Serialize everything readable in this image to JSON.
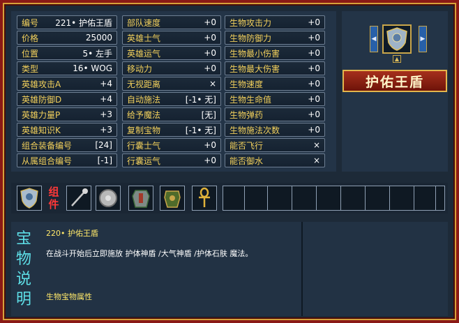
{
  "stats": {
    "col1": [
      {
        "label": "编号",
        "value": "221• 护佑王盾"
      },
      {
        "label": "价格",
        "value": "25000"
      },
      {
        "label": "位置",
        "value": "5• 左手"
      },
      {
        "label": "类型",
        "value": "16• WOG"
      },
      {
        "label": "英雄攻击A",
        "value": "+4"
      },
      {
        "label": "英雄防御D",
        "value": "+4"
      },
      {
        "label": "英雄力量P",
        "value": "+3"
      },
      {
        "label": "英雄知识K",
        "value": "+3"
      },
      {
        "label": "组合装备编号",
        "value": "[24]"
      },
      {
        "label": "从属组合编号",
        "value": "[-1]"
      }
    ],
    "col2": [
      {
        "label": "部队速度",
        "value": "+0"
      },
      {
        "label": "英雄士气",
        "value": "+0"
      },
      {
        "label": "英雄运气",
        "value": "+0"
      },
      {
        "label": "移动力",
        "value": "+0"
      },
      {
        "label": "无视距离",
        "value": "×"
      },
      {
        "label": "自动施法",
        "value": "[-1• 无]"
      },
      {
        "label": "给予魔法",
        "value": "[无]"
      },
      {
        "label": "复制宝物",
        "value": "[-1• 无]"
      },
      {
        "label": "行囊士气",
        "value": "+0"
      },
      {
        "label": "行囊运气",
        "value": "+0"
      }
    ],
    "col3": [
      {
        "label": "生物攻击力",
        "value": "+0"
      },
      {
        "label": "生物防御力",
        "value": "+0"
      },
      {
        "label": "生物最小伤害",
        "value": "+0"
      },
      {
        "label": "生物最大伤害",
        "value": "+0"
      },
      {
        "label": "生物速度",
        "value": "+0"
      },
      {
        "label": "生物生命值",
        "value": "+0"
      },
      {
        "label": "生物弹药",
        "value": "+0"
      },
      {
        "label": "生物施法次数",
        "value": "+0"
      },
      {
        "label": "能否飞行",
        "value": "×"
      },
      {
        "label": "能否御水",
        "value": "×"
      }
    ]
  },
  "artifact": {
    "name": "护佑王盾",
    "prev_label": "◀",
    "next_label": "▶",
    "up_label": "▲"
  },
  "components": {
    "label": "组件",
    "filled_icons": [
      "shield-icon",
      "scepter-icon",
      "round-shield-icon",
      "armor-icon",
      "chest-armor-icon",
      "ankh-icon"
    ],
    "empty_slot_count": 10
  },
  "info": {
    "side_label": "宝物说明",
    "title": "220• 护佑王盾",
    "description": "在战斗开始后立即施放 护体神盾 /大气神盾 /护体石肤 魔法。",
    "property": "生物宝物属性"
  },
  "colors": {
    "frame": "#8a1a16",
    "gold": "#d6a23a",
    "label_gold": "#f2d05c",
    "side_cyan": "#5ee0e8",
    "component_red": "#ff3838"
  }
}
